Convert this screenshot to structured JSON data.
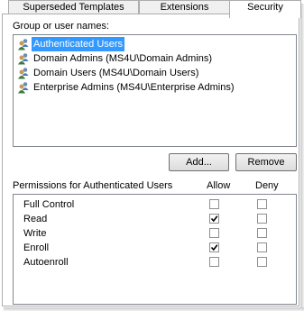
{
  "tabs": [
    {
      "label": "Superseded Templates"
    },
    {
      "label": "Extensions"
    },
    {
      "label": "Security",
      "active": true
    }
  ],
  "groups": {
    "label": "Group or user names:",
    "items": [
      {
        "name": "Authenticated Users",
        "selected": true,
        "icon": "users-group-icon"
      },
      {
        "name": "Domain Admins (MS4U\\Domain Admins)",
        "selected": false,
        "icon": "users-group-icon"
      },
      {
        "name": "Domain Users (MS4U\\Domain Users)",
        "selected": false,
        "icon": "users-group-icon"
      },
      {
        "name": "Enterprise Admins (MS4U\\Enterprise Admins)",
        "selected": false,
        "icon": "users-group-icon"
      }
    ]
  },
  "buttons": {
    "add": "Add...",
    "remove": "Remove"
  },
  "permissions": {
    "label": "Permissions for Authenticated Users",
    "allow_label": "Allow",
    "deny_label": "Deny",
    "rows": [
      {
        "name": "Full Control",
        "allow": false,
        "deny": false
      },
      {
        "name": "Read",
        "allow": true,
        "deny": false
      },
      {
        "name": "Write",
        "allow": false,
        "deny": false
      },
      {
        "name": "Enroll",
        "allow": true,
        "deny": false
      },
      {
        "name": "Autoenroll",
        "allow": false,
        "deny": false
      }
    ]
  },
  "colors": {
    "selection": "#3399ff",
    "border": "#adadad"
  }
}
